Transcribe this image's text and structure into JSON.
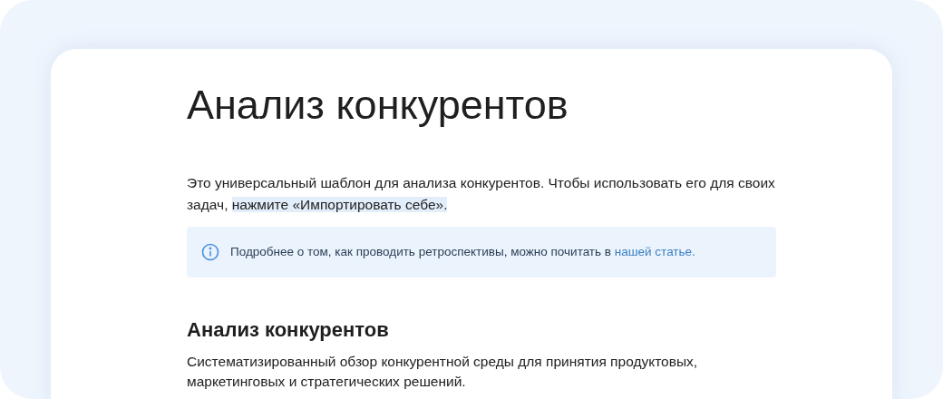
{
  "title": "Анализ конкурентов",
  "intro": {
    "text": "Это универсальный шаблон для анализа конкурентов. Чтобы использовать его для своих задач,",
    "highlight": "нажмите «Импортировать себе»."
  },
  "callout": {
    "text": "Подробнее о том, как проводить ретроспективы, можно почитать в",
    "link": "нашей статье."
  },
  "section": {
    "heading": "Анализ конкурентов",
    "text": "Систематизированный обзор конкурентной среды для принятия продуктовых, маркетинговых и стратегических решений."
  }
}
